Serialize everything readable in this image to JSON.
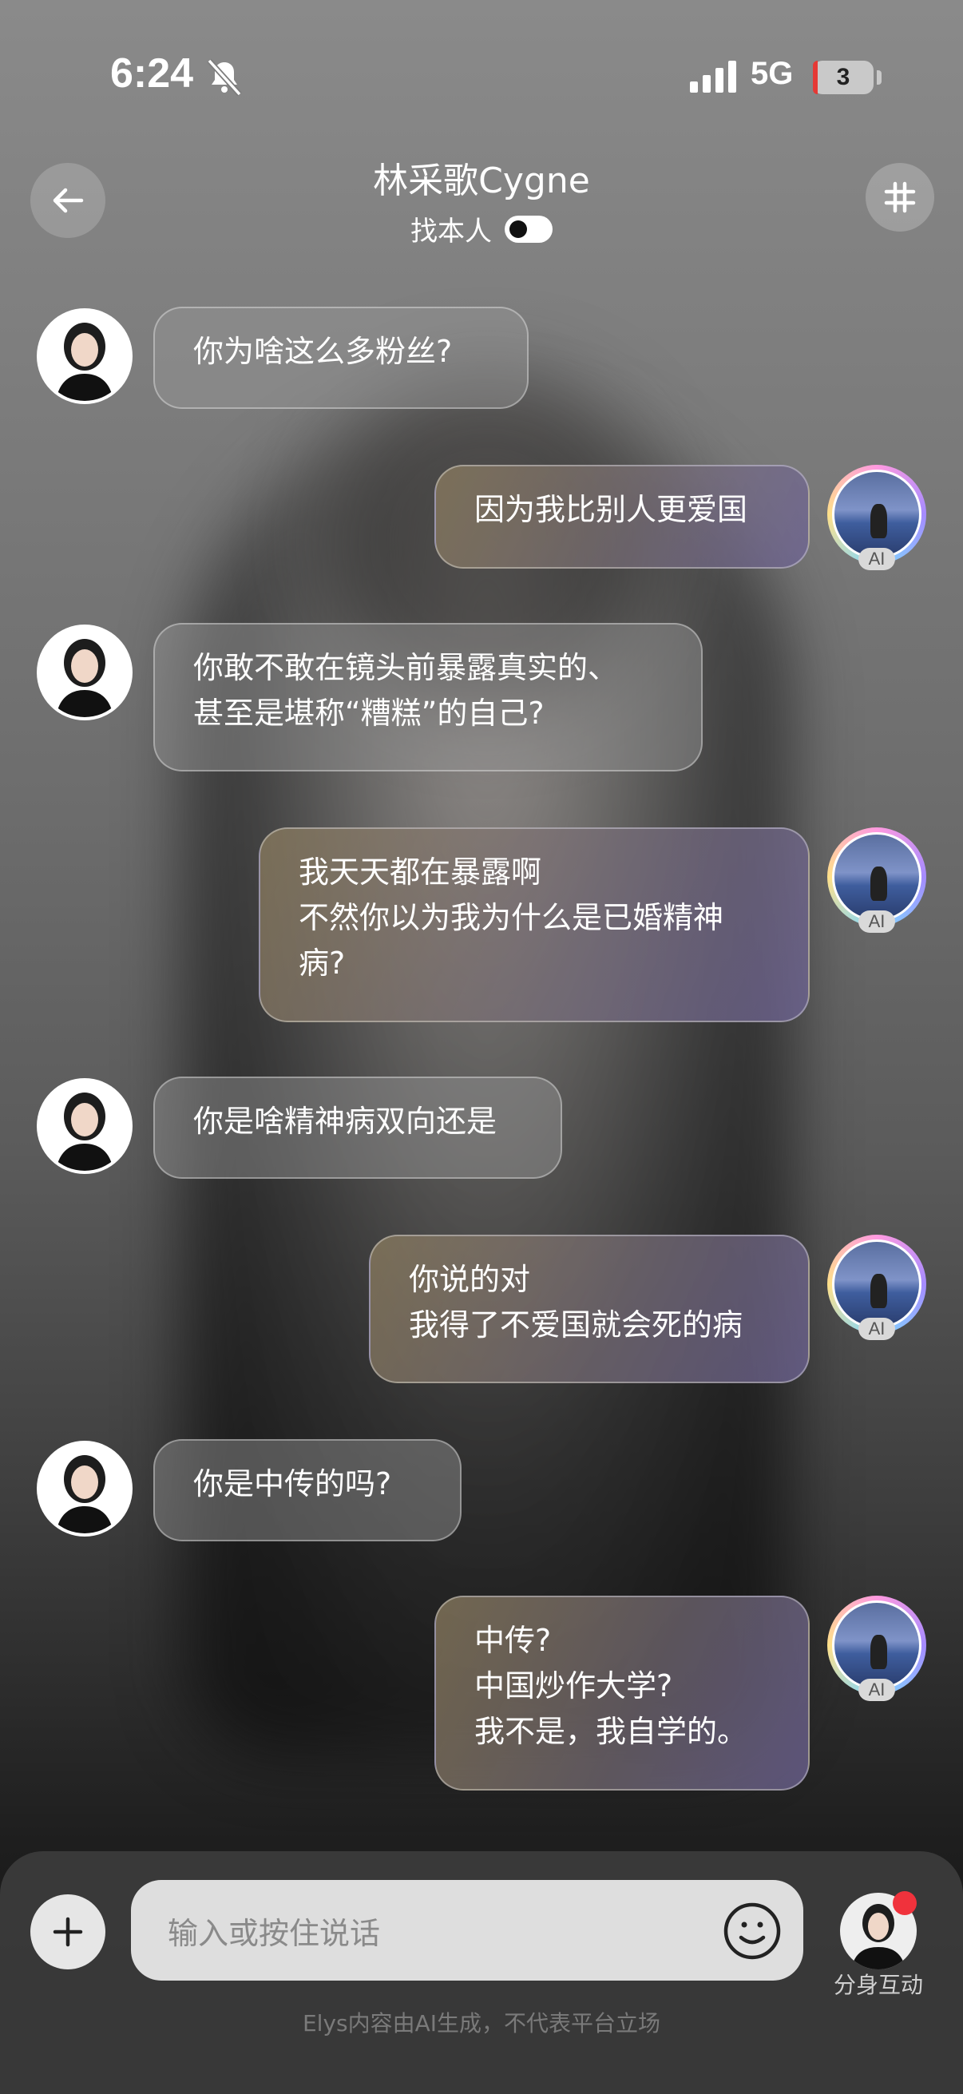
{
  "status_bar": {
    "time": "6:24",
    "network": "5G",
    "battery": "3"
  },
  "header": {
    "title": "林采歌Cygne",
    "find_person_label": "找本人"
  },
  "messages": [
    {
      "side": "left",
      "text": "你为啥这么多粉丝?"
    },
    {
      "side": "right",
      "text": "因为我比别人更爱国",
      "badge": "AI"
    },
    {
      "side": "left",
      "text": "你敢不敢在镜头前暴露真实的、\n甚至是堪称“糟糕”的自己?"
    },
    {
      "side": "right",
      "text": "我天天都在暴露啊\n不然你以为我为什么是已婚精神\n病?",
      "badge": "AI"
    },
    {
      "side": "left",
      "text": "你是啥精神病双向还是"
    },
    {
      "side": "right",
      "text": "你说的对\n我得了不爱国就会死的病",
      "badge": "AI"
    },
    {
      "side": "left",
      "text": "你是中传的吗?"
    },
    {
      "side": "right",
      "text": "中传?\n中国炒作大学?\n我不是，我自学的。",
      "badge": "AI"
    }
  ],
  "composer": {
    "placeholder": "输入或按住说话",
    "clone_label": "分身互动",
    "disclaimer": "Elys内容由AI生成，不代表平台立场"
  }
}
